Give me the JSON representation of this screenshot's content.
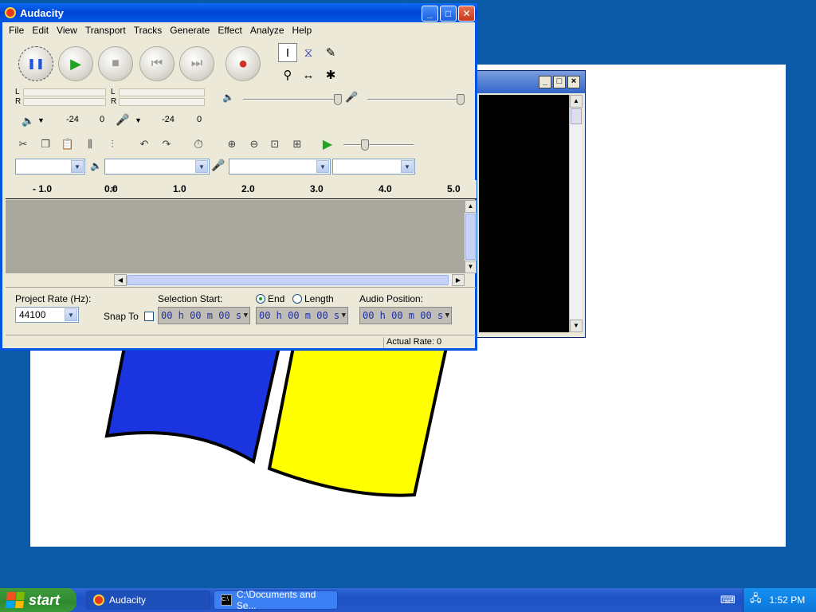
{
  "audacity": {
    "title": "Audacity",
    "menu": [
      "File",
      "Edit",
      "View",
      "Transport",
      "Tracks",
      "Generate",
      "Effect",
      "Analyze",
      "Help"
    ],
    "meters": {
      "left_channel": "L",
      "right_channel": "R",
      "minus24": "-24",
      "zero": "0"
    },
    "ruler": [
      "- 1.0",
      "0.0",
      "1.0",
      "2.0",
      "3.0",
      "4.0",
      "5.0"
    ],
    "selection": {
      "project_rate_label": "Project Rate (Hz):",
      "project_rate_value": "44100",
      "snap_to_label": "Snap To",
      "selection_start_label": "Selection Start:",
      "end_label": "End",
      "length_label": "Length",
      "audio_position_label": "Audio Position:",
      "time_value": "00 h 00 m 00 s"
    },
    "status": {
      "actual_rate": "Actual Rate: 0"
    }
  },
  "taskbar": {
    "start_label": "start",
    "tasks": [
      "Audacity",
      "C:\\Documents and Se..."
    ],
    "clock": "1:52 PM"
  },
  "colors": {
    "desktop": "#0b5aa8",
    "flag_blue": "#1a35e0",
    "flag_yellow": "#ffff00",
    "track_bg": "#aaa89e"
  }
}
